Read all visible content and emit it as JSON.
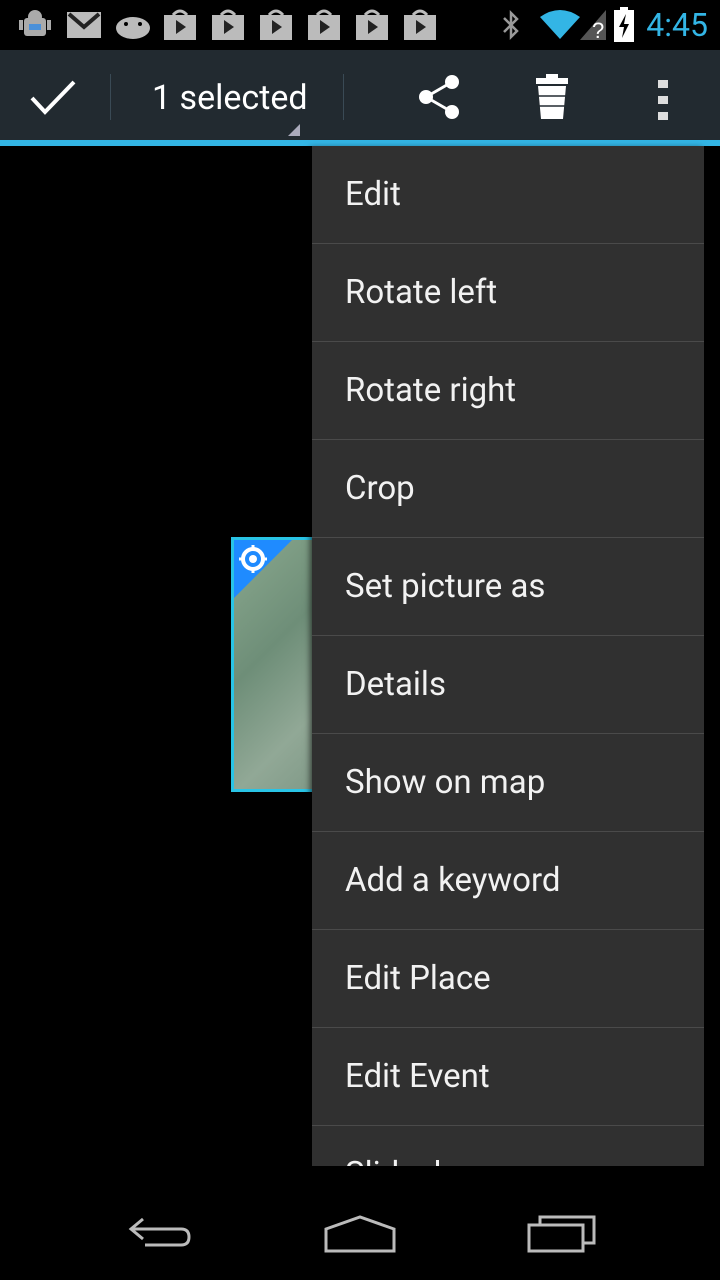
{
  "status_bar": {
    "time": "4:45",
    "colors": {
      "clock": "#33b5e5"
    },
    "notification_icons": [
      "android-debug-icon",
      "gmail-icon",
      "android-icon",
      "play-store-icon",
      "play-store-icon",
      "play-store-icon",
      "play-store-icon",
      "play-store-icon",
      "play-store-icon"
    ],
    "system_icons": [
      "bluetooth-icon",
      "wifi-icon",
      "signal-unknown-icon",
      "battery-charging-icon"
    ]
  },
  "action_bar": {
    "selection_label": "1 selected",
    "icons": [
      "checkmark-icon",
      "share-icon",
      "trash-icon",
      "overflow-menu-icon"
    ],
    "accent_color": "#33b5e5"
  },
  "menu": {
    "items": [
      {
        "label": "Edit"
      },
      {
        "label": "Rotate left"
      },
      {
        "label": "Rotate right"
      },
      {
        "label": "Crop"
      },
      {
        "label": "Set picture as"
      },
      {
        "label": "Details"
      },
      {
        "label": "Show on map"
      },
      {
        "label": "Add a keyword"
      },
      {
        "label": "Edit Place"
      },
      {
        "label": "Edit Event"
      },
      {
        "label": "Slideshow"
      }
    ]
  },
  "nav_bar": {
    "icons": [
      "back-icon",
      "home-icon",
      "recents-icon"
    ]
  }
}
